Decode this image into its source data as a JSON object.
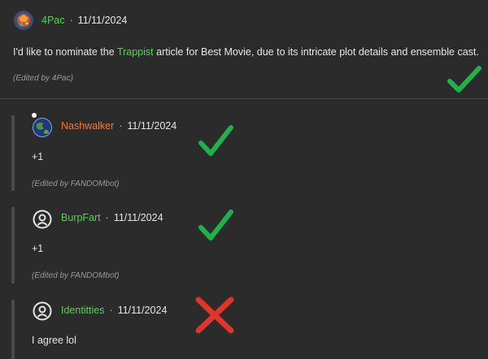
{
  "colors": {
    "background": "#2b2b2b",
    "text": "#e6e6e6",
    "link_green": "#4cd94c",
    "user_orange": "#f27b35",
    "edited_gray": "#9a9a9a",
    "check_green": "#1fb24a",
    "cross_red": "#e0352b"
  },
  "top_comment": {
    "username": "4Pac",
    "separator": "·",
    "date": "11/11/2024",
    "text_before": "I'd like to nominate the ",
    "link_text": "Trappist",
    "text_after": " article for Best Movie, due to its intricate plot details and ensemble cast.",
    "edited": "(Edited by 4Pac)",
    "verdict_icon": "check-icon"
  },
  "replies": [
    {
      "username": "Nashwalker",
      "separator": "·",
      "date": "11/11/2024",
      "text": "+1",
      "edited": "(Edited by FANDOMbot)",
      "verdict_icon": "check-icon"
    },
    {
      "username": "BurpFart",
      "separator": "·",
      "date": "11/11/2024",
      "text": "+1",
      "edited": "(Edited by FANDOMbot)",
      "verdict_icon": "check-icon"
    },
    {
      "username": "Identitties",
      "separator": "·",
      "date": "11/11/2024",
      "text": "I agree lol",
      "edited": "",
      "verdict_icon": "cross-icon"
    }
  ]
}
